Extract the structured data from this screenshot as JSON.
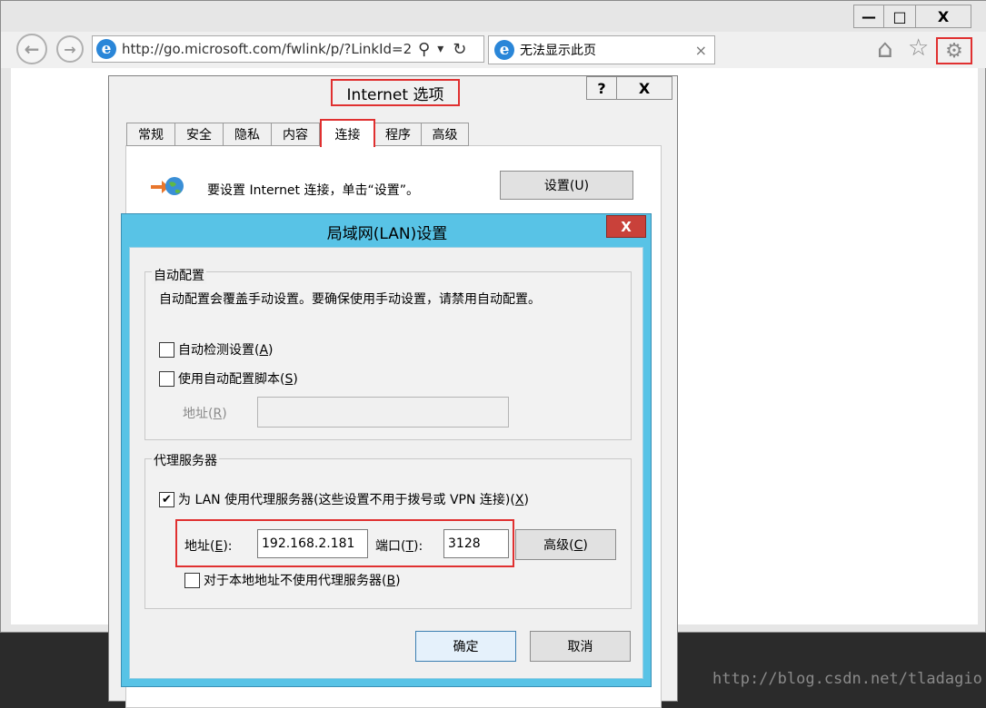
{
  "browser": {
    "address_url": "http://go.microsoft.com/fwlink/p/?LinkId=2!",
    "tab_title": "无法显示此页",
    "tab_close_glyph": "×",
    "window_controls": {
      "minimize": "—",
      "maximize": "□",
      "close": "X"
    },
    "nav": {
      "back": "←",
      "forward": "→",
      "search": "⚲",
      "dropdown": "▾",
      "refresh": "↻",
      "home": "⌂",
      "favorites": "☆",
      "tools": "⚙"
    }
  },
  "options_dialog": {
    "title": "Internet 选项",
    "help_label": "?",
    "close_label": "X",
    "tabs": [
      "常规",
      "安全",
      "隐私",
      "内容",
      "连接",
      "程序",
      "高级"
    ],
    "active_tab": "连接",
    "setup_text": "要设置 Internet 连接，单击“设置”。",
    "setup_button": "设置(U)"
  },
  "lan_dialog": {
    "title": "局域网(LAN)设置",
    "close_label": "X",
    "auto_config": {
      "legend": "自动配置",
      "description": "自动配置会覆盖手动设置。要确保使用手动设置，请禁用自动配置。",
      "auto_detect": {
        "label_pre": "自动检测设置(",
        "key": "A",
        "label_post": ")",
        "checked": false
      },
      "use_script": {
        "label_pre": "使用自动配置脚本(",
        "key": "S",
        "label_post": ")",
        "checked": false
      },
      "address": {
        "label_pre": "地址(",
        "key": "R",
        "label_post": ")",
        "value": ""
      }
    },
    "proxy": {
      "legend": "代理服务器",
      "use_proxy": {
        "label_pre": "为 LAN 使用代理服务器(这些设置不用于拨号或 VPN 连接)(",
        "key": "X",
        "label_post": ")",
        "checked": true
      },
      "address": {
        "label_pre": "地址(",
        "key": "E",
        "label_post": "):",
        "value": "192.168.2.181"
      },
      "port": {
        "label_pre": "端口(",
        "key": "T",
        "label_post": "):",
        "value": "3128"
      },
      "advanced_button": {
        "label_pre": "高级(",
        "key": "C",
        "label_post": ")"
      },
      "bypass_local": {
        "label_pre": "对于本地地址不使用代理服务器(",
        "key": "B",
        "label_post": ")",
        "checked": false
      }
    },
    "ok_button": "确定",
    "cancel_button": "取消"
  },
  "check_glyph": "✔",
  "watermark": "http://blog.csdn.net/tladagio",
  "colors": {
    "lan_title_bar": "#58c3e6",
    "close_button": "#c9413a",
    "highlight": "#e03030"
  }
}
